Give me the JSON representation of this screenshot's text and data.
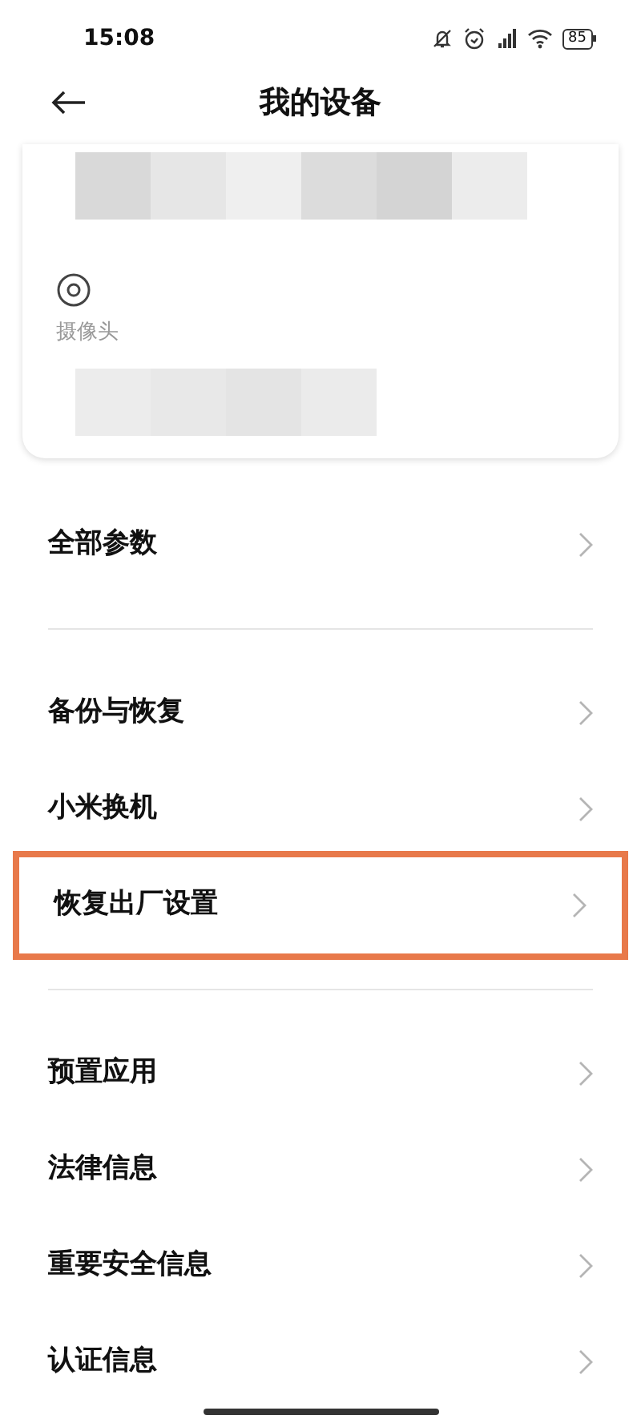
{
  "status_bar": {
    "time": "15:08",
    "battery": "85"
  },
  "header": {
    "title": "我的设备"
  },
  "device_card": {
    "camera_label": "摄像头"
  },
  "groups": [
    {
      "items": [
        {
          "label": "全部参数",
          "highlighted": false
        }
      ]
    },
    {
      "items": [
        {
          "label": "备份与恢复",
          "highlighted": false
        },
        {
          "label": "小米换机",
          "highlighted": false
        },
        {
          "label": "恢复出厂设置",
          "highlighted": true
        }
      ]
    },
    {
      "items": [
        {
          "label": "预置应用",
          "highlighted": false
        },
        {
          "label": "法律信息",
          "highlighted": false
        },
        {
          "label": "重要安全信息",
          "highlighted": false
        },
        {
          "label": "认证信息",
          "highlighted": false
        }
      ]
    }
  ]
}
